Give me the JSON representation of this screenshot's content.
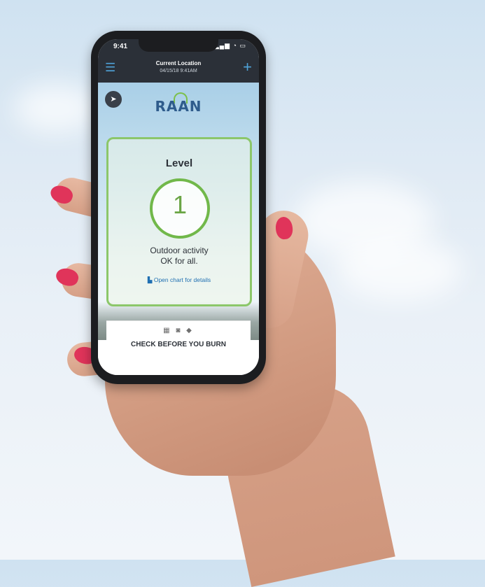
{
  "status_bar": {
    "time": "9:41",
    "signal_icons": "signal-wifi-battery"
  },
  "app_bar": {
    "title": "Current Location",
    "date": "04/15/18 9:41AM",
    "menu_icon": "hamburger-icon",
    "add_icon": "plus-icon"
  },
  "brand": {
    "logo_text": "RAAN",
    "accent_color": "#7cc04b",
    "logo_color": "#2f5c8c"
  },
  "status_card": {
    "heading": "Level",
    "level_value": "1",
    "message_line1": "Outdoor activity",
    "message_line2": "OK for all.",
    "link_text": "Open chart for details",
    "card_color": "#8cc76a"
  },
  "banner": {
    "text": "CHECK BEFORE YOU BURN"
  }
}
